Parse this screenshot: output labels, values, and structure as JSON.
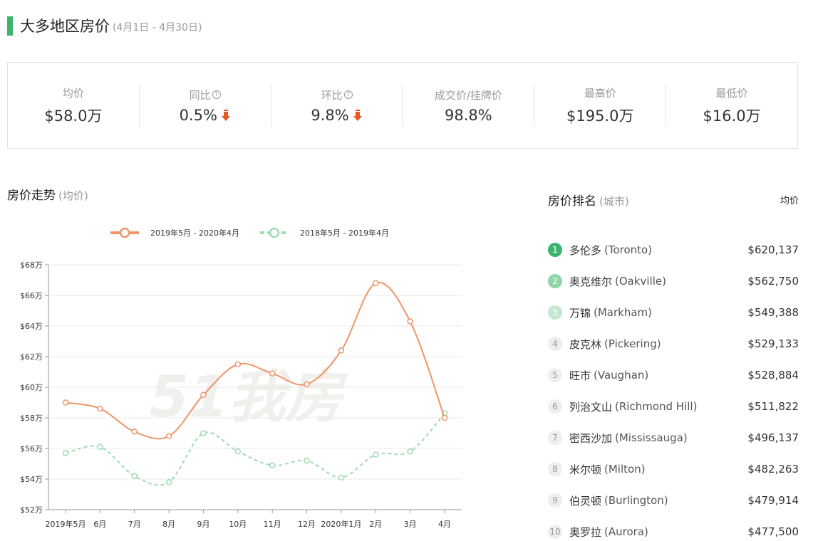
{
  "header": {
    "title": "大多地区房价",
    "date_range": "(4月1日 - 4月30日)",
    "accent_color": "#3cb46e"
  },
  "stats": [
    {
      "label": "均价",
      "value": "$58.0万",
      "help": false,
      "arrow": false
    },
    {
      "label": "同比",
      "value": "0.5%",
      "help": true,
      "arrow": "down"
    },
    {
      "label": "环比",
      "value": "9.8%",
      "help": true,
      "arrow": "down"
    },
    {
      "label": "成交价/挂牌价",
      "value": "98.8%",
      "help": false,
      "arrow": false
    },
    {
      "label": "最高价",
      "value": "$195.0万",
      "help": false,
      "arrow": false
    },
    {
      "label": "最低价",
      "value": "$16.0万",
      "help": false,
      "arrow": false
    }
  ],
  "trend": {
    "title": "房价走势",
    "subtitle": "(均价)",
    "watermark": "51我房"
  },
  "ranking": {
    "title": "房价排名",
    "subtitle": "(城市)",
    "avg_label": "均价",
    "items": [
      {
        "rank": "1",
        "name": "多伦多",
        "en": "(Toronto)",
        "price": "$620,137"
      },
      {
        "rank": "2",
        "name": "奥克维尔",
        "en": "(Oakville)",
        "price": "$562,750"
      },
      {
        "rank": "3",
        "name": "万锦",
        "en": "(Markham)",
        "price": "$549,388"
      },
      {
        "rank": "4",
        "name": "皮克林",
        "en": "(Pickering)",
        "price": "$529,133"
      },
      {
        "rank": "5",
        "name": "旺市",
        "en": "(Vaughan)",
        "price": "$528,884"
      },
      {
        "rank": "6",
        "name": "列治文山",
        "en": "(Richmond Hill)",
        "price": "$511,822"
      },
      {
        "rank": "7",
        "name": "密西沙加",
        "en": "(Mississauga)",
        "price": "$496,137"
      },
      {
        "rank": "8",
        "name": "米尔顿",
        "en": "(Milton)",
        "price": "$482,263"
      },
      {
        "rank": "9",
        "name": "伯灵顿",
        "en": "(Burlington)",
        "price": "$479,914"
      },
      {
        "rank": "10",
        "name": "奥罗拉",
        "en": "(Aurora)",
        "price": "$477,500"
      }
    ]
  },
  "chart_data": {
    "type": "line",
    "categories": [
      "2019年5月",
      "6月",
      "7月",
      "8月",
      "9月",
      "10月",
      "11月",
      "12月",
      "2020年1月",
      "2月",
      "3月",
      "4月"
    ],
    "ylim": [
      52,
      68
    ],
    "yticks": [
      52,
      54,
      56,
      58,
      60,
      62,
      64,
      66,
      68
    ],
    "ytick_labels": [
      "$52万",
      "$54万",
      "$56万",
      "$58万",
      "$60万",
      "$62万",
      "$64万",
      "$66万",
      "$68万"
    ],
    "grid": true,
    "legend_position": "top-center",
    "series": [
      {
        "name": "2019年5月 - 2020年4月",
        "color": "#f0956b",
        "dashed": false,
        "values": [
          59.0,
          58.6,
          57.1,
          56.8,
          59.5,
          61.5,
          60.9,
          60.2,
          62.4,
          66.8,
          64.3,
          58.0
        ]
      },
      {
        "name": "2018年5月 - 2019年4月",
        "color": "#9edcb3",
        "dashed": true,
        "values": [
          55.7,
          56.1,
          54.2,
          53.8,
          57.0,
          55.8,
          54.9,
          55.2,
          54.1,
          55.6,
          55.8,
          58.3
        ]
      }
    ]
  }
}
